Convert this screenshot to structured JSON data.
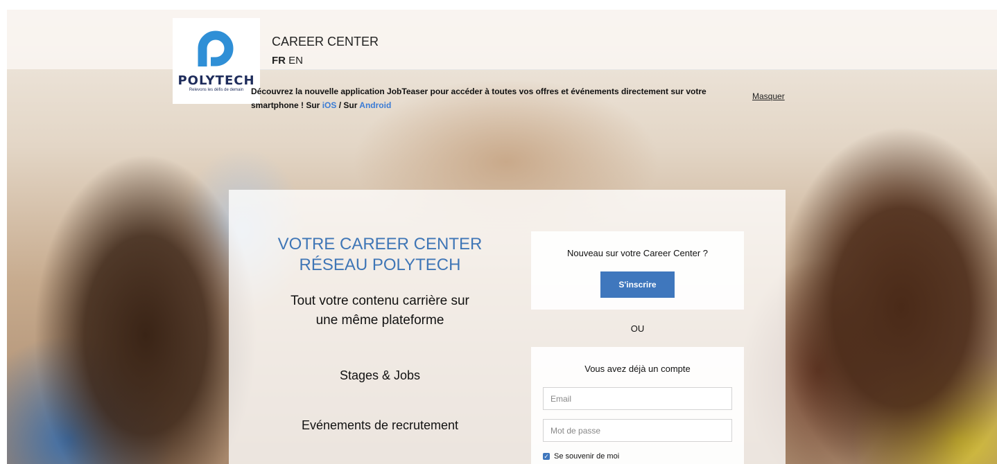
{
  "header": {
    "logo_brand": "POLYTECH",
    "logo_tagline": "Relevons les défis de demain",
    "title": "CAREER CENTER",
    "lang_fr": "FR",
    "lang_en": "EN"
  },
  "banner": {
    "text": "Découvrez la nouvelle application JobTeaser pour accéder à toutes vos offres et événements directement sur votre smartphone ! Sur",
    "ios_label": "iOS",
    "separator": "/ Sur",
    "android_label": "Android",
    "hide_label": "Masquer"
  },
  "pitch": {
    "title_line1": "VOTRE CAREER CENTER",
    "title_line2": "RÉSEAU POLYTECH",
    "subtitle_line1": "Tout votre contenu carrière sur",
    "subtitle_line2": "une même plateforme",
    "feature1": "Stages & Jobs",
    "feature2": "Evénements de recrutement"
  },
  "signup": {
    "question": "Nouveau sur votre Career Center ?",
    "button_label": "S'inscrire"
  },
  "or_label": "OU",
  "login": {
    "question": "Vous avez déjà un compte",
    "email_placeholder": "Email",
    "password_placeholder": "Mot de passe",
    "remember_label": "Se souvenir de moi",
    "remember_checked": true
  },
  "colors": {
    "accent": "#3f77bd",
    "title_blue": "#3f76b6",
    "logo_blue": "#2f8fd6",
    "logo_navy": "#1e2c5b"
  }
}
